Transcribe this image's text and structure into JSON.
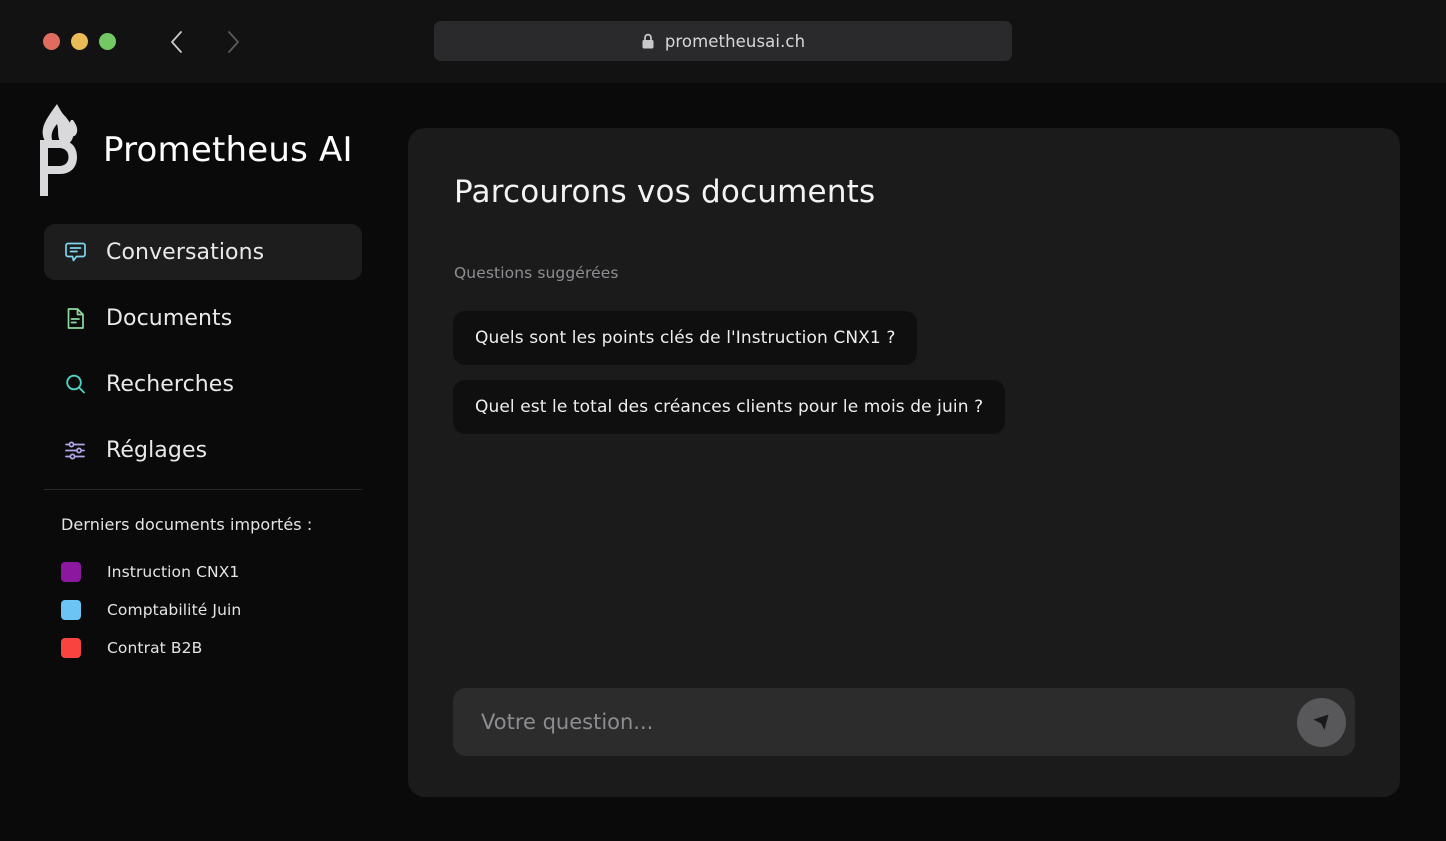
{
  "browser": {
    "url": "prometheusai.ch",
    "lock_icon": "lock-icon",
    "back_icon": "chevron-left-icon",
    "forward_icon": "chevron-right-icon",
    "traffic_lights": [
      {
        "name": "close",
        "color": "#e06c60"
      },
      {
        "name": "minimize",
        "color": "#e9bb54"
      },
      {
        "name": "maximize",
        "color": "#73c863"
      }
    ]
  },
  "sidebar": {
    "brand_name": "Prometheus AI",
    "brand_logo_icon": "prometheus-flame-p-logo",
    "nav_items": [
      {
        "label": "Conversations",
        "icon": "chat-bubble-icon",
        "color": "#7fd4ee",
        "active": true
      },
      {
        "label": "Documents",
        "icon": "document-icon",
        "color": "#8fd99f",
        "active": false
      },
      {
        "label": "Recherches",
        "icon": "search-icon",
        "color": "#4fd6c4",
        "active": false
      },
      {
        "label": "Réglages",
        "icon": "sliders-icon",
        "color": "#b1a7e8",
        "active": false
      }
    ],
    "documents_title": "Derniers documents importés :",
    "documents": [
      {
        "label": "Instruction CNX1",
        "color": "#8b189e"
      },
      {
        "label": "Comptabilité Juin",
        "color": "#6cc4f5"
      },
      {
        "label": "Contrat B2B",
        "color": "#f8433f"
      }
    ]
  },
  "main": {
    "title": "Parcourons vos documents",
    "suggested_label": "Questions suggérées",
    "suggested_questions": [
      "Quels sont les points clés de l'Instruction CNX1 ?",
      "Quel est le total des créances clients pour le mois de juin ?"
    ],
    "composer": {
      "placeholder": "Votre question...",
      "value": "",
      "send_icon": "send-arrow-icon"
    }
  },
  "colors": {
    "background": "#0a0a0b",
    "panel": "#1b1b1c",
    "chip": "#0f0f10",
    "browser_bar": "#121213",
    "accent_cyan": "#7fd4ee"
  }
}
